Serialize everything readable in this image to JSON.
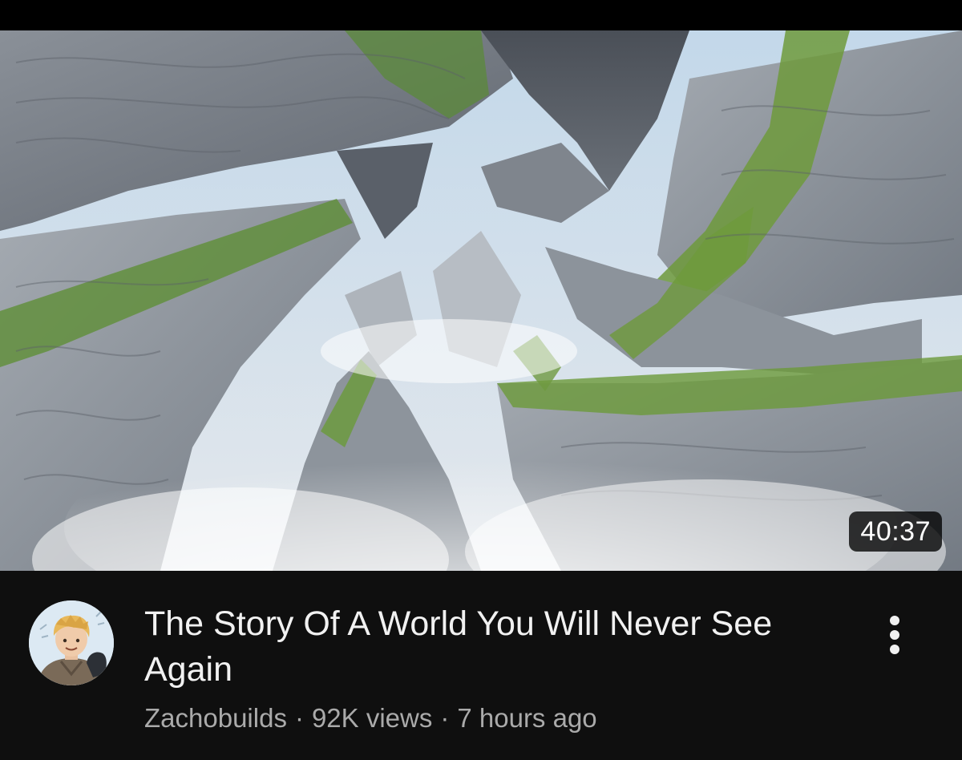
{
  "video": {
    "title": "The Story Of A World You Will Never See Again",
    "duration": "40:37",
    "channel": "Zachobuilds",
    "separator": "·",
    "views": "92K views",
    "age": "7 hours ago"
  },
  "icons": {
    "more": "more-vert-icon",
    "avatar": "channel-avatar"
  },
  "colors": {
    "background": "#0f0f0f",
    "title": "#f1f1f1",
    "meta": "#aaaaaa",
    "badge_bg": "#000000"
  }
}
